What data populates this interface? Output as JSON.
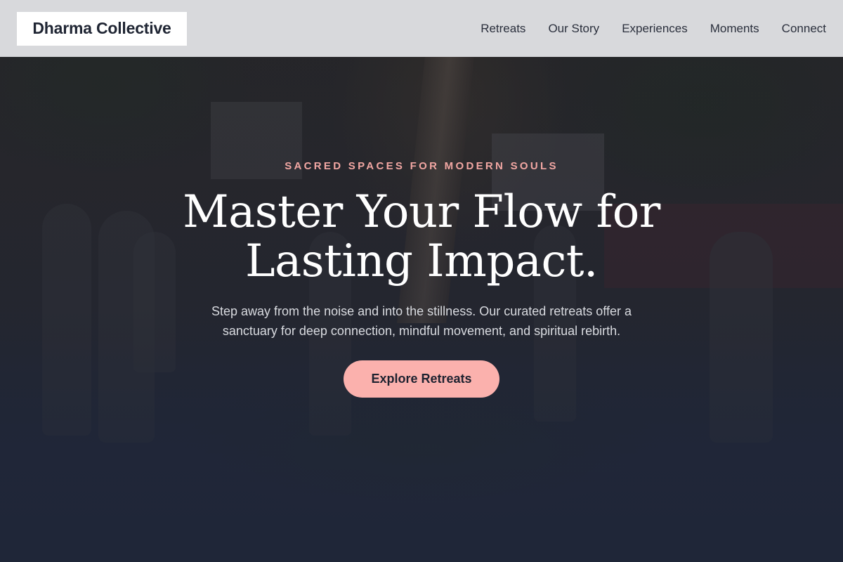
{
  "brand": {
    "name": "Dharma Collective"
  },
  "nav": {
    "items": [
      {
        "label": "Retreats"
      },
      {
        "label": "Our Story"
      },
      {
        "label": "Experiences"
      },
      {
        "label": "Moments"
      },
      {
        "label": "Connect"
      }
    ]
  },
  "hero": {
    "eyebrow": "SACRED SPACES FOR MODERN SOULS",
    "headline_line1": "Master Your Flow for",
    "headline_line2": "Lasting Impact.",
    "subtext": "Step away from the noise and into the stillness. Our curated retreats offer a sanctuary for deep connection, mindful movement, and spiritual rebirth.",
    "cta_label": "Explore Retreats",
    "background_image": "outdoor-yoga-group-photo"
  },
  "colors": {
    "accent": "#fbb1ad",
    "eyebrow": "#f2a7a3",
    "header_bg": "#dedfe2",
    "page_bg": "#1f2638"
  }
}
